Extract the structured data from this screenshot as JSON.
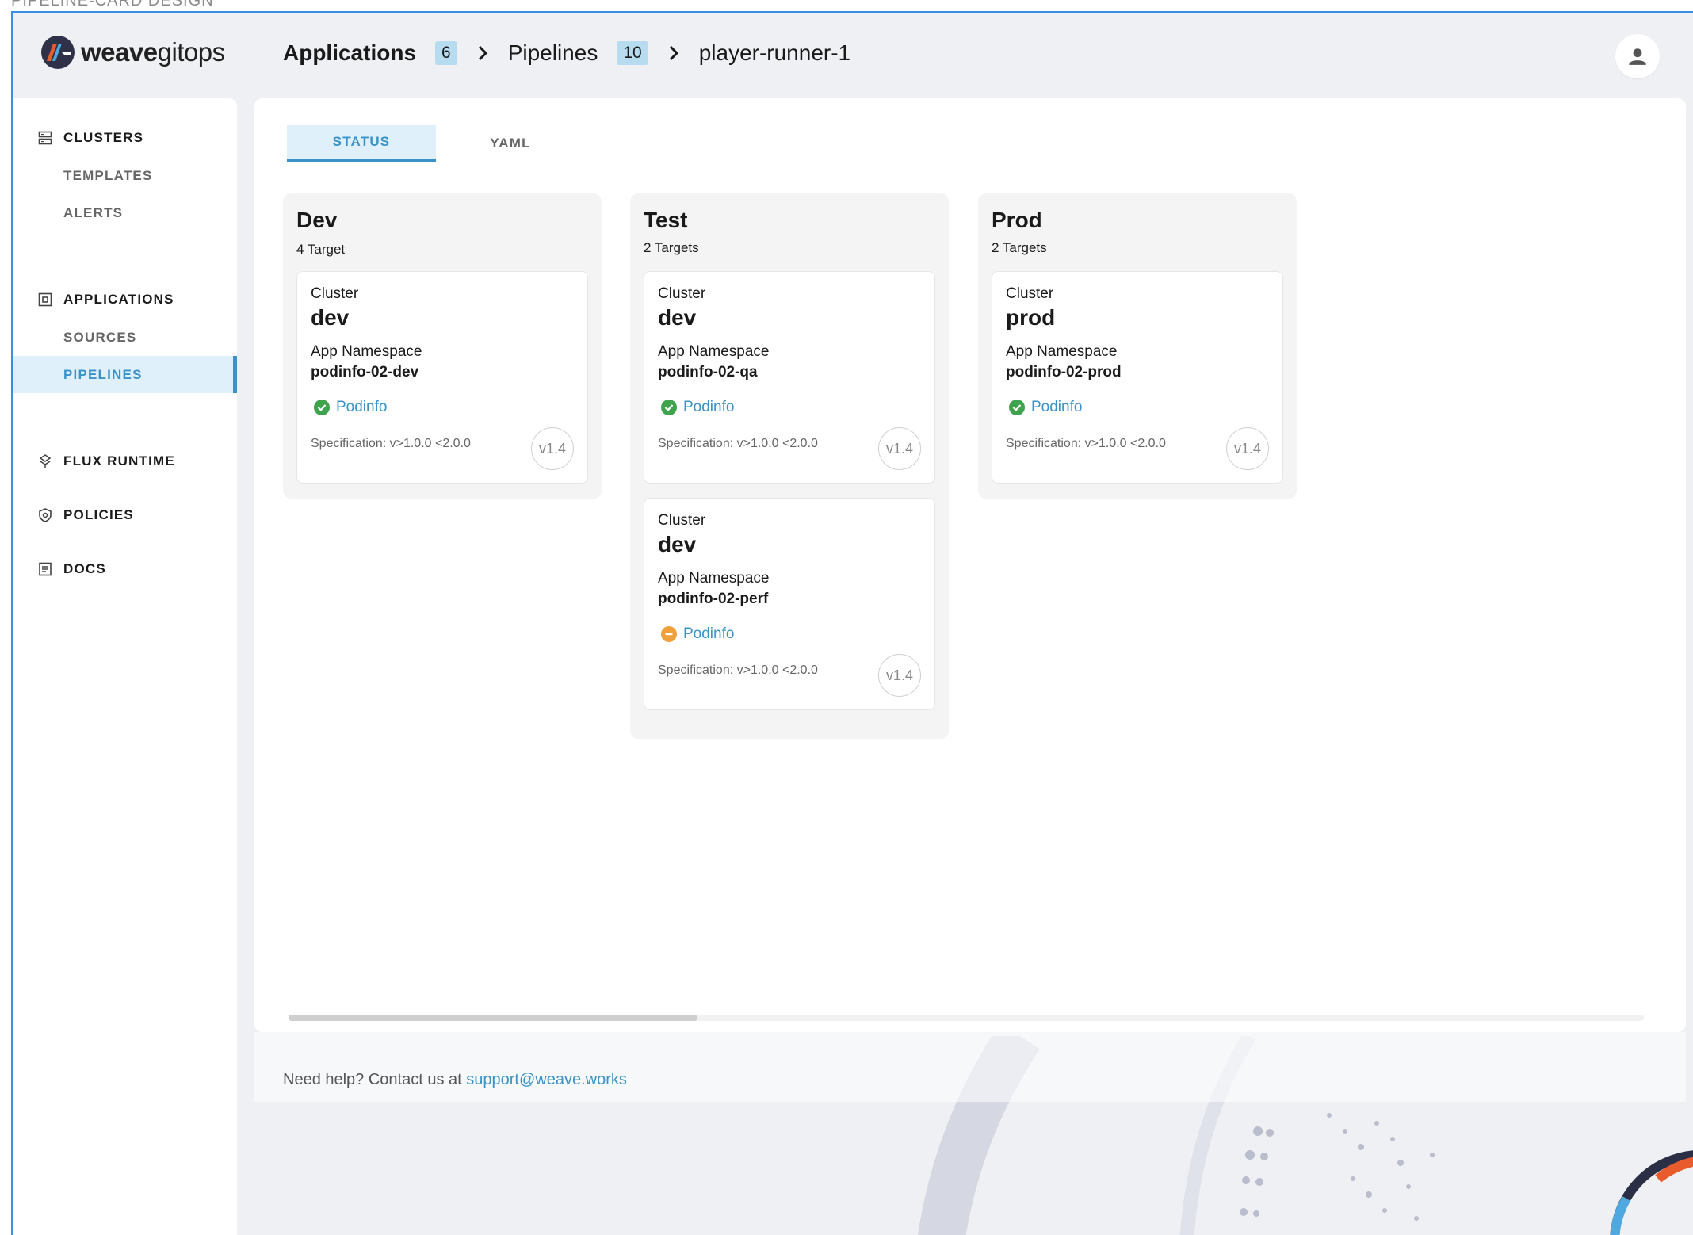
{
  "frame": {
    "title": "PIPELINE-CARD DESIGN"
  },
  "brand": {
    "name_bold": "weave",
    "name_rest": "gitops"
  },
  "colors": {
    "accent": "#3993c9",
    "success": "#3fa34d",
    "warning": "#f0a13b"
  },
  "breadcrumb": [
    {
      "label": "Applications",
      "count": "6"
    },
    {
      "label": "Pipelines",
      "count": "10"
    },
    {
      "label": "player-runner-1"
    }
  ],
  "sidebar": {
    "groups": [
      {
        "label": "CLUSTERS",
        "icon": "clusters-icon",
        "items": [
          "TEMPLATES",
          "ALERTS"
        ]
      },
      {
        "label": "APPLICATIONS",
        "icon": "applications-icon",
        "items": [
          "SOURCES",
          "PIPELINES"
        ],
        "active_item": "PIPELINES"
      },
      {
        "label": "FLUX RUNTIME",
        "icon": "flux-icon",
        "items": []
      },
      {
        "label": "POLICIES",
        "icon": "policies-icon",
        "items": []
      },
      {
        "label": "DOCS",
        "icon": "docs-icon",
        "items": []
      }
    ]
  },
  "tabs": [
    {
      "label": "STATUS",
      "active": true
    },
    {
      "label": "YAML",
      "active": false
    }
  ],
  "environments": [
    {
      "name": "Dev",
      "targets": "4 Target",
      "cards": [
        {
          "cluster_label": "Cluster",
          "cluster": "dev",
          "ns_label": "App Namespace",
          "namespace": "podinfo-02-dev",
          "app": "Podinfo",
          "status": "success",
          "spec": "Specification: v>1.0.0 <2.0.0",
          "version": "v1.4"
        }
      ]
    },
    {
      "name": "Test",
      "targets": "2 Targets",
      "cards": [
        {
          "cluster_label": "Cluster",
          "cluster": "dev",
          "ns_label": "App Namespace",
          "namespace": "podinfo-02-qa",
          "app": "Podinfo",
          "status": "success",
          "spec": "Specification: v>1.0.0 <2.0.0",
          "version": "v1.4"
        },
        {
          "cluster_label": "Cluster",
          "cluster": "dev",
          "ns_label": "App Namespace",
          "namespace": "podinfo-02-perf",
          "app": "Podinfo",
          "status": "warning",
          "spec": "Specification: v>1.0.0 <2.0.0",
          "version": "v1.4"
        }
      ]
    },
    {
      "name": "Prod",
      "targets": "2 Targets",
      "cards": [
        {
          "cluster_label": "Cluster",
          "cluster": "prod",
          "ns_label": "App Namespace",
          "namespace": "podinfo-02-prod",
          "app": "Podinfo",
          "status": "success",
          "spec": "Specification: v>1.0.0 <2.0.0",
          "version": "v1.4"
        }
      ]
    }
  ],
  "footer": {
    "text": "Need help? Contact us at",
    "email": "support@weave.works"
  }
}
